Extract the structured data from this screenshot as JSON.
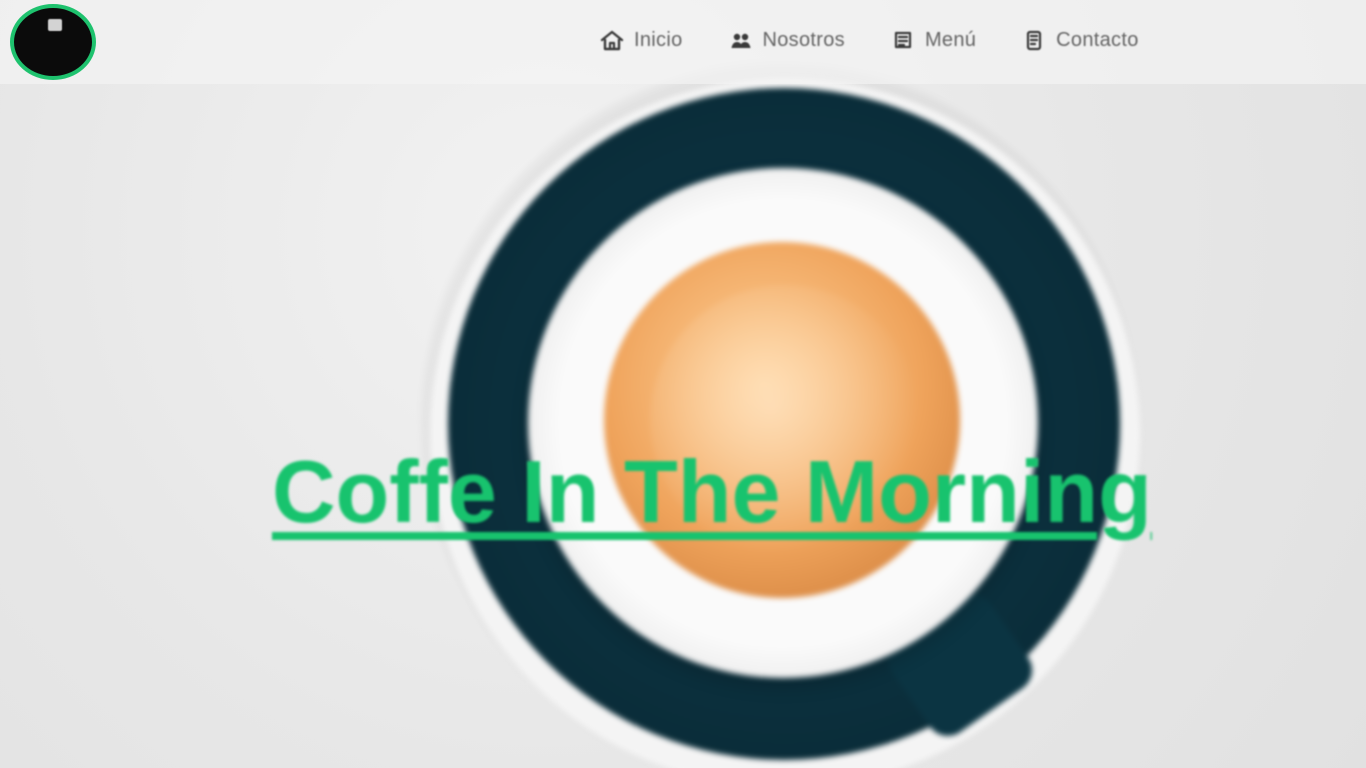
{
  "header": {
    "logo_name": "cafe-logo"
  },
  "nav": {
    "items": [
      {
        "label": "Inicio",
        "icon": "home-icon"
      },
      {
        "label": "Nosotros",
        "icon": "people-icon"
      },
      {
        "label": "Menú",
        "icon": "menu-icon"
      },
      {
        "label": "Contacto",
        "icon": "contact-icon"
      }
    ]
  },
  "hero": {
    "title": "Coffe In The Morning",
    "accent_color": "#18c36e"
  }
}
